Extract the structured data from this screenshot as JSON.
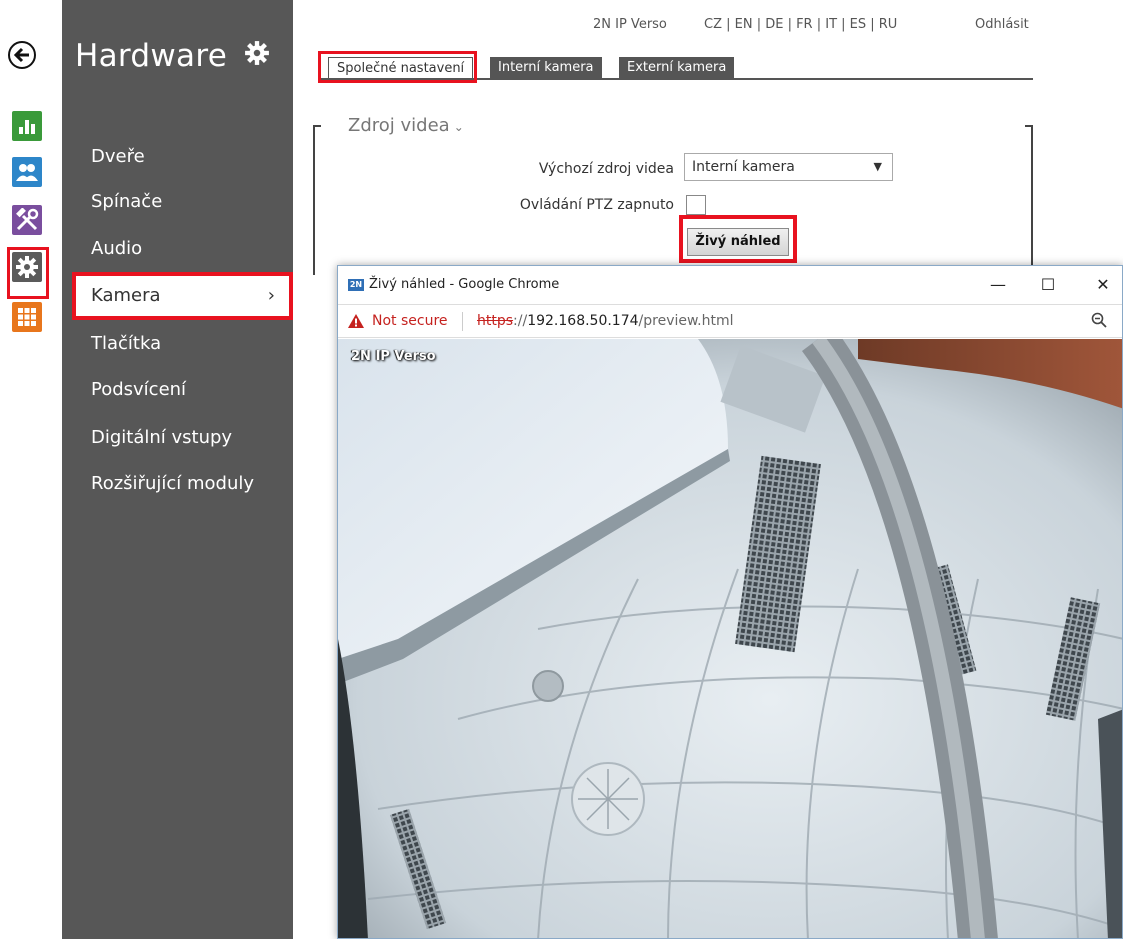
{
  "rail": {
    "icons": [
      "back-icon",
      "status-icon",
      "directory-icon",
      "services-icon",
      "hardware-icon",
      "system-icon"
    ]
  },
  "sidemenu": {
    "title": "Hardware",
    "items": [
      {
        "label": "Dveře"
      },
      {
        "label": "Spínače"
      },
      {
        "label": "Audio"
      },
      {
        "label": "Kamera",
        "chevron": "›"
      },
      {
        "label": "Tlačítka"
      },
      {
        "label": "Podsvícení"
      },
      {
        "label": "Digitální vstupy"
      },
      {
        "label": "Rozšiřující moduly"
      }
    ]
  },
  "topbar": {
    "device": "2N IP Verso",
    "languages": "CZ | EN | DE | FR | IT | ES | RU",
    "logout": "Odhlásit"
  },
  "tabs": [
    {
      "label": "Společné nastavení"
    },
    {
      "label": "Interní kamera"
    },
    {
      "label": "Externí kamera"
    }
  ],
  "section": {
    "title": "Zdroj videa",
    "caret": "⌄",
    "default_source_label": "Výchozí zdroj videa",
    "default_source_value": "Interní kamera",
    "select_arrow": "▼",
    "ptz_label": "Ovládání PTZ zapnuto",
    "preview_button": "Živý náhled"
  },
  "popup": {
    "favicon": "2N",
    "title": "Živý náhled - Google Chrome",
    "min": "—",
    "max": "☐",
    "close": "✕",
    "not_secure": "Not secure",
    "url_proto": "https",
    "url_sep": "://",
    "url_rest": "192.168.50.174",
    "url_path": "/preview.html",
    "camera_label": "2N IP Verso"
  },
  "colors": {
    "highlight": "#e8121f",
    "menu_bg": "#575757"
  }
}
